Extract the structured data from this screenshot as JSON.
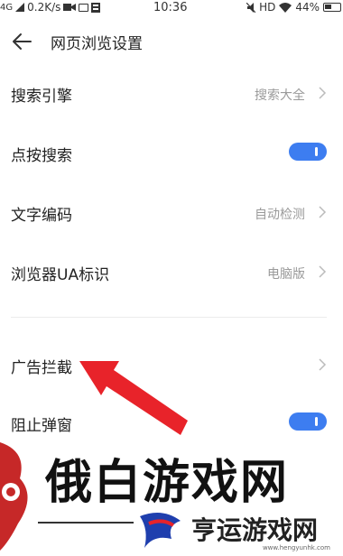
{
  "statusbar": {
    "network": "4G",
    "speed": "0.2K/s",
    "time": "10:36",
    "net_label": "HD",
    "battery": "44%"
  },
  "header": {
    "title": "网页浏览设置"
  },
  "settings": [
    {
      "label": "搜索引擎",
      "value": "搜索大全",
      "type": "chevron"
    },
    {
      "label": "点按搜索",
      "type": "toggle",
      "enabled": true
    },
    {
      "label": "文字编码",
      "value": "自动检测",
      "type": "chevron"
    },
    {
      "label": "浏览器UA标识",
      "value": "电脑版",
      "type": "chevron"
    },
    {
      "label": "广告拦截",
      "type": "chevron"
    },
    {
      "label": "阻止弹窗",
      "type": "toggle",
      "enabled": true
    }
  ],
  "watermark": {
    "main": "俄白游戏网",
    "secondary": "亨运游戏网",
    "url": "www.hengyunhk.com"
  },
  "colors": {
    "toggle_on": "#3d7df0",
    "arrow": "#e8232a",
    "value_text": "#9a9a9a"
  }
}
